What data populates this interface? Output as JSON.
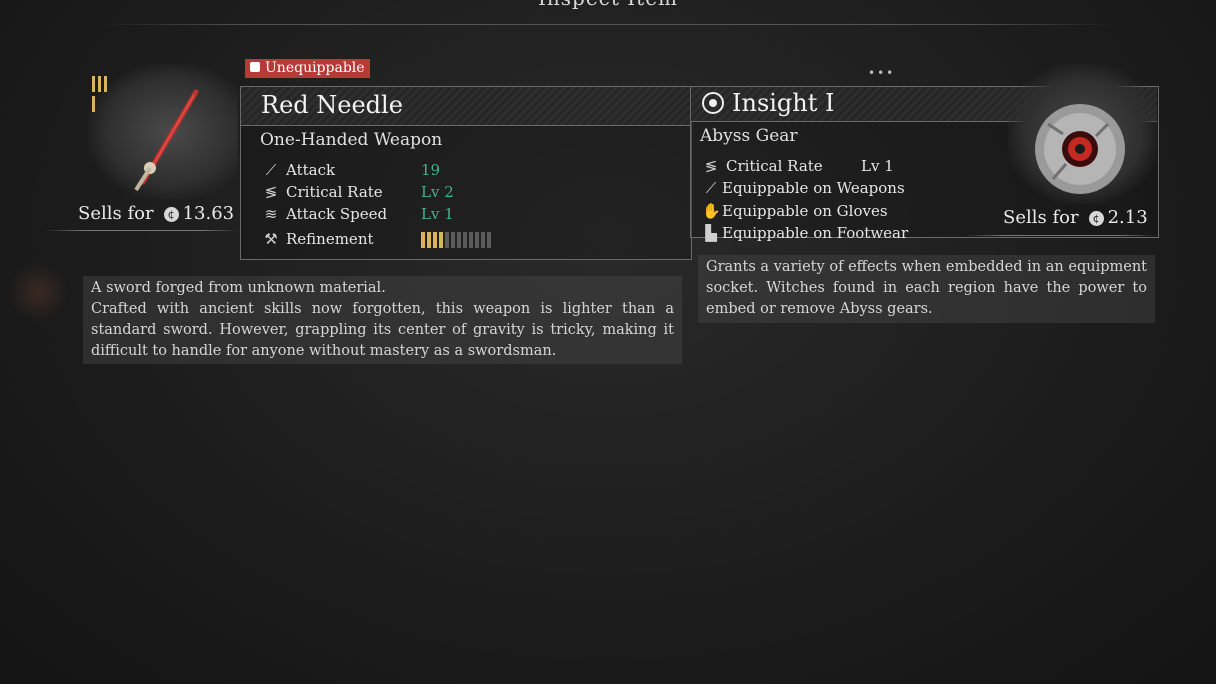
{
  "window": {
    "title": "Inspect Item"
  },
  "left_item": {
    "badge": "Unequippable",
    "name": "Red Needle",
    "type": "One-Handed Weapon",
    "stats": [
      {
        "label": "Attack",
        "value": "19",
        "icon": "sword-icon"
      },
      {
        "label": "Critical Rate",
        "value": "Lv 2",
        "icon": "critical-rate-icon"
      },
      {
        "label": "Attack Speed",
        "value": "Lv 1",
        "icon": "attack-speed-icon"
      }
    ],
    "refinement": {
      "label": "Refinement",
      "filled": 4,
      "total": 12
    },
    "sells_label": "Sells for",
    "price": "13.63",
    "description": [
      "A sword forged from unknown material.",
      "Crafted with ancient skills now forgotten, this weapon is lighter than a standard sword. However, grappling its center of gravity is tricky, making it difficult to handle for anyone without mastery as a swordsman."
    ],
    "colors": {
      "badge": "#b83a36",
      "stat_value": "#3fb58a",
      "refine_on": "#d9b45a"
    }
  },
  "right_item": {
    "name": "Insight I",
    "type": "Abyss Gear",
    "stats": [
      {
        "label": "Critical Rate",
        "value": "Lv 1",
        "icon": "critical-rate-icon"
      },
      {
        "label": "Equippable on Weapons",
        "icon": "weapon-icon"
      },
      {
        "label": "Equippable on Gloves",
        "icon": "glove-icon"
      },
      {
        "label": "Equippable on Footwear",
        "icon": "boot-icon"
      }
    ],
    "sells_label": "Sells for",
    "price": "2.13",
    "description": "Grants a variety of effects when embedded in an equipment socket. Witches found in each region have the power to embed or remove Abyss gears."
  },
  "pager": "•••"
}
